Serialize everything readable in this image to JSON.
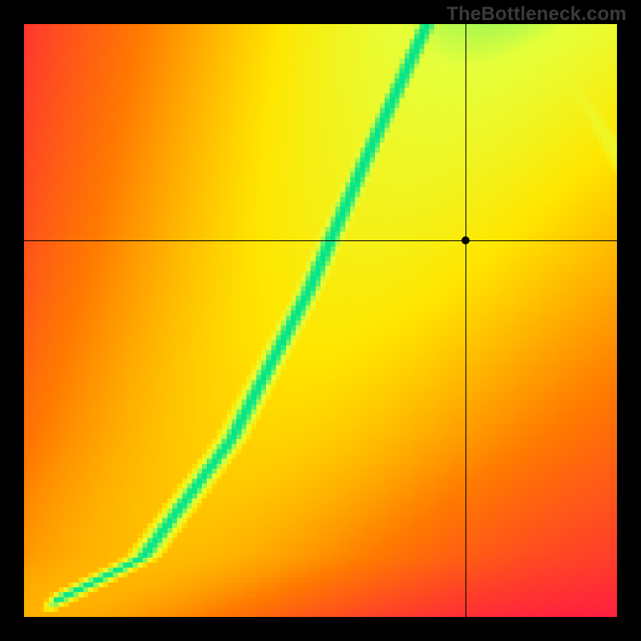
{
  "watermark": "TheBottleneck.com",
  "chart_data": {
    "type": "heatmap",
    "title": "",
    "xlabel": "",
    "ylabel": "",
    "xlim": [
      0,
      1
    ],
    "ylim": [
      0,
      1
    ],
    "grid": false,
    "legend": false,
    "colormap_stops": [
      {
        "t": 0.0,
        "hex": "#ff1744"
      },
      {
        "t": 0.4,
        "hex": "#ff7a00"
      },
      {
        "t": 0.7,
        "hex": "#ffe600"
      },
      {
        "t": 0.88,
        "hex": "#e5ff3a"
      },
      {
        "t": 1.0,
        "hex": "#00e48a"
      }
    ],
    "resolution": 120,
    "optimal_ridge": {
      "description": "Green optimal band follows a superlinear curve from (0,0) toward upper area; crosshair marker sits to the right of the ridge in the orange/yellow zone.",
      "control_points_xy": [
        [
          0.0,
          0.0
        ],
        [
          0.2,
          0.1
        ],
        [
          0.35,
          0.3
        ],
        [
          0.48,
          0.55
        ],
        [
          0.58,
          0.78
        ],
        [
          0.68,
          1.0
        ]
      ],
      "band_halfwidth_x": 0.05,
      "falloff_softness": 0.42
    },
    "secondary_lobe": {
      "description": "Yellow/green secondary tongue entering from top-right corner",
      "control_points_xy": [
        [
          1.0,
          0.78
        ],
        [
          0.95,
          0.86
        ],
        [
          0.88,
          0.96
        ],
        [
          0.84,
          1.0
        ]
      ],
      "band_halfwidth_x": 0.06,
      "strength": 0.82
    },
    "crosshair": {
      "x": 0.745,
      "y": 0.635
    }
  }
}
